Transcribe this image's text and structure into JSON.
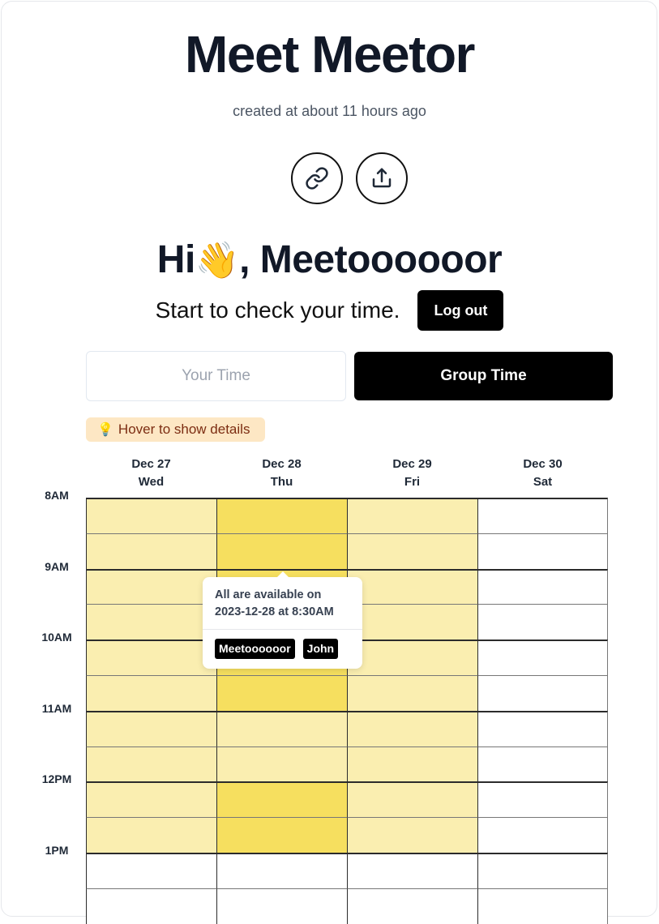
{
  "event": {
    "title": "Meet Meetor",
    "created": "created at about 11 hours ago"
  },
  "actions": [
    {
      "name": "copy-link",
      "icon": "link-icon"
    },
    {
      "name": "share",
      "icon": "share-icon"
    }
  ],
  "user": {
    "greeting_prefix": "Hi",
    "wave_emoji": "👋",
    "greeting_suffix": ", Meetoooooor",
    "prompt": "Start to check your time.",
    "logout_label": "Log out"
  },
  "tabs": {
    "your_time": "Your Time",
    "group_time": "Group Time",
    "active": "group_time"
  },
  "hint": {
    "icon": "💡",
    "text": "Hover to show details"
  },
  "colors": {
    "available_all": "#f6df5f",
    "available_some": "#faeeb0",
    "unavailable": "#ffffff"
  },
  "schedule": {
    "days": [
      {
        "date": "Dec 27",
        "weekday": "Wed"
      },
      {
        "date": "Dec 28",
        "weekday": "Thu"
      },
      {
        "date": "Dec 29",
        "weekday": "Fri"
      },
      {
        "date": "Dec 30",
        "weekday": "Sat"
      }
    ],
    "hour_labels": [
      "8AM",
      "9AM",
      "10AM",
      "11AM",
      "12PM",
      "1PM"
    ],
    "slots": [
      "8:00AM",
      "8:30AM",
      "9:00AM",
      "9:30AM",
      "10:00AM",
      "10:30AM",
      "11:00AM",
      "11:30AM",
      "12:00PM",
      "12:30PM",
      "1:00PM",
      "1:30PM"
    ],
    "availability_levels_legend": {
      "0": "none",
      "1": "some",
      "2": "all"
    },
    "availability": [
      [
        1,
        1,
        1,
        1,
        1,
        1,
        1,
        1,
        1,
        1,
        0,
        0
      ],
      [
        2,
        2,
        2,
        2,
        2,
        2,
        1,
        1,
        2,
        2,
        0,
        0
      ],
      [
        1,
        1,
        1,
        1,
        1,
        1,
        1,
        1,
        1,
        1,
        0,
        0
      ],
      [
        0,
        0,
        0,
        0,
        0,
        0,
        0,
        0,
        0,
        0,
        0,
        0
      ]
    ]
  },
  "tooltip": {
    "line1": "All are available on",
    "line2": "2023-12-28 at 8:30AM",
    "participants": [
      "Meetoooooor",
      "John"
    ]
  }
}
